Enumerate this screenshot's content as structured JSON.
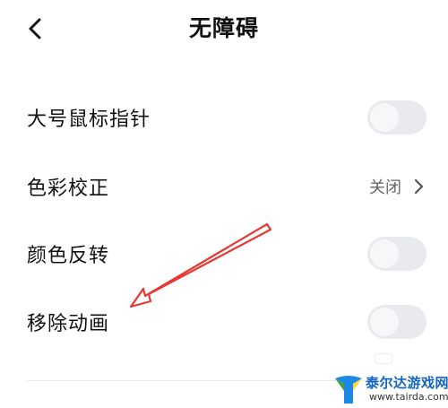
{
  "header": {
    "title": "无障碍",
    "back_icon": "chevron-left-icon"
  },
  "settings": [
    {
      "label": "大号鼠标指针",
      "control": "toggle",
      "on": false
    },
    {
      "label": "色彩校正",
      "control": "link",
      "value": "关闭"
    },
    {
      "label": "颜色反转",
      "control": "toggle",
      "on": false
    },
    {
      "label": "移除动画",
      "control": "toggle",
      "on": false
    }
  ],
  "colors": {
    "toggle_track": "#e9eaee",
    "toggle_knob": "#f7f7f9",
    "annotation_arrow": "#e53935",
    "watermark_text": "#1565c0"
  },
  "watermark": {
    "name": "泰尔达游戏网",
    "url": "www.tairda.com"
  }
}
